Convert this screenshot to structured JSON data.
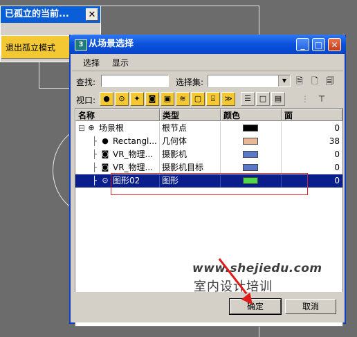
{
  "isolate_panel": {
    "title": "已孤立的当前...",
    "close_label": "✕",
    "exit_button": "退出孤立模式"
  },
  "dialog": {
    "title": "从场景选择",
    "menu": [
      "选择",
      "显示"
    ],
    "find_label": "查找:",
    "find_value": "",
    "selection_set_label": "选择集:",
    "selection_set_value": "",
    "viewport_label": "视口:",
    "columns": [
      "名称",
      "类型",
      "颜色",
      "面"
    ],
    "rows": [
      {
        "name": "场景根",
        "type": "根节点",
        "color": "#000000",
        "faces": "0",
        "icon": "scene-root-icon",
        "indent": 0
      },
      {
        "name": "Rectangl...",
        "type": "几何体",
        "color": "#e8b896",
        "faces": "38",
        "icon": "geometry-sphere-icon",
        "indent": 1
      },
      {
        "name": "VR_物理...",
        "type": "摄影机",
        "color": "#5b78c8",
        "faces": "0",
        "icon": "camera-icon",
        "indent": 1
      },
      {
        "name": "VR_物理...",
        "type": "摄影机目标",
        "color": "#5b78c8",
        "faces": "0",
        "icon": "camera-target-icon",
        "indent": 1
      },
      {
        "name": "图形02",
        "type": "图形",
        "color": "#4fd84a",
        "faces": "0",
        "icon": "shape-icon",
        "indent": 1,
        "selected": true
      }
    ],
    "ok_button": "确定",
    "cancel_button": "取消"
  },
  "watermark": {
    "url": "www.shejiedu.com",
    "text": "室内设计培训"
  }
}
